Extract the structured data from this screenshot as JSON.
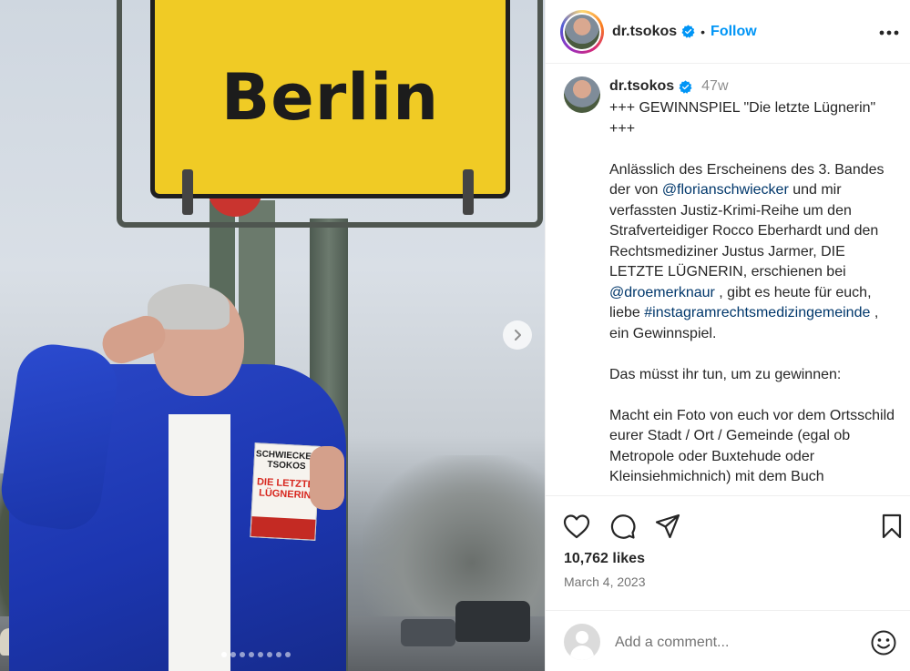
{
  "media": {
    "sign_text": "Berlin",
    "book_author": "SCHWIECKER TSOKOS",
    "book_title": "DIE LETZTE LÜGNERIN",
    "carousel_total": 8,
    "carousel_active": 1
  },
  "header": {
    "username": "dr.tsokos",
    "separator": "•",
    "follow_label": "Follow"
  },
  "caption": {
    "username": "dr.tsokos",
    "time": "47w",
    "p1": "+++ GEWINNSPIEL \"Die letzte Lügnerin\" +++",
    "p2_a": "Anlässlich des Erscheinens des 3. Bandes der von ",
    "mention1": "@florianschwiecker",
    "p2_b": " und mir verfassten Justiz-Krimi-Reihe um den Strafverteidiger Rocco Eberhardt und den Rechtsmediziner Justus Jarmer, DIE LETZTE LÜGNERIN, erschienen bei ",
    "mention2": "@droemerknaur",
    "p2_c": " , gibt es heute für euch, liebe ",
    "hashtag": "#instagramrechtsmedizingemeinde",
    "p2_d": " , ein Gewinnspiel.",
    "p3": "Das müsst ihr tun, um zu gewinnen:",
    "p4": "Macht ein Foto von euch vor dem Ortsschild eurer Stadt / Ort / Gemeinde (egal ob Metropole oder Buxtehude oder Kleinsiehmichnich) mit dem Buch"
  },
  "stats": {
    "likes": "10,762 likes",
    "date": "March 4, 2023"
  },
  "comment": {
    "placeholder": "Add a comment..."
  },
  "icons": {
    "like": "heart-icon",
    "comment": "comment-icon",
    "share": "share-icon",
    "save": "bookmark-icon",
    "more": "more-icon",
    "emoji": "emoji-icon",
    "next": "chevron-right-icon",
    "verified": "verified-badge-icon"
  },
  "colors": {
    "accent": "#0095f6",
    "link": "#00376b",
    "verified": "#0095f6",
    "muted": "#737373"
  }
}
